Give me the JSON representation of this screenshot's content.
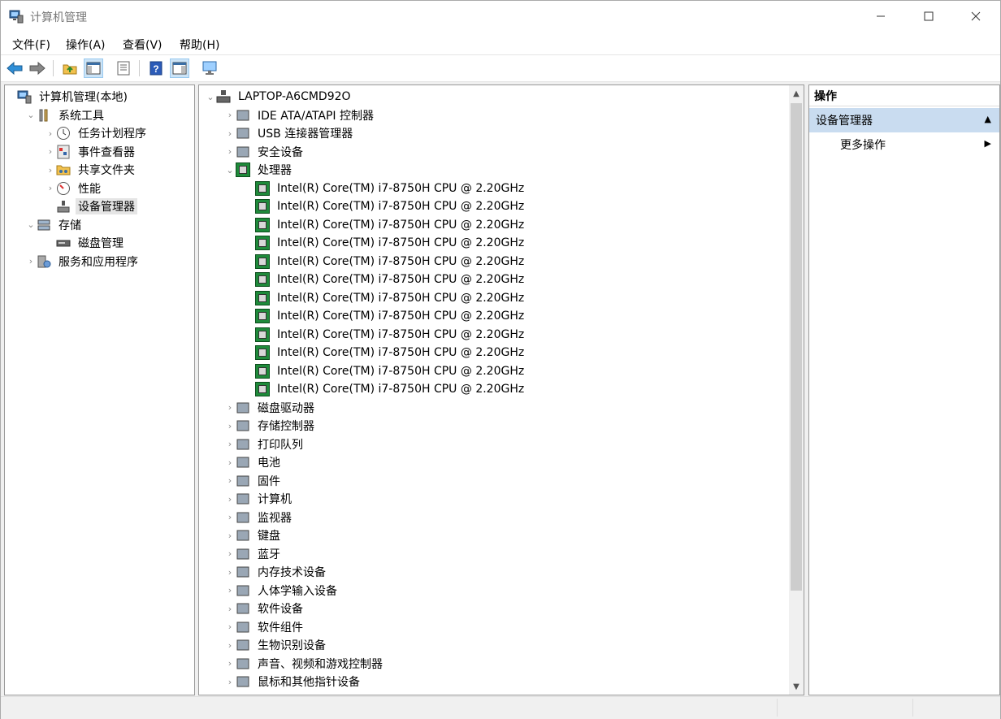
{
  "window": {
    "title": "计算机管理"
  },
  "menu": [
    "文件(F)",
    "操作(A)",
    "查看(V)",
    "帮助(H)"
  ],
  "toolbar": [
    "back-icon",
    "forward-icon",
    "up-folder-icon",
    "show-hide-tree-icon",
    "properties-icon",
    "help-icon",
    "show-action-pane-icon",
    "monitor-icon"
  ],
  "left_tree": [
    {
      "label": "计算机管理(本地)",
      "icon": "computer-management-icon",
      "level": 0,
      "chev": ""
    },
    {
      "label": "系统工具",
      "icon": "tools-icon",
      "level": 1,
      "chev": "expanded"
    },
    {
      "label": "任务计划程序",
      "icon": "clock-icon",
      "level": 2,
      "chev": "collapsed"
    },
    {
      "label": "事件查看器",
      "icon": "event-viewer-icon",
      "level": 2,
      "chev": "collapsed"
    },
    {
      "label": "共享文件夹",
      "icon": "shared-folder-icon",
      "level": 2,
      "chev": "collapsed"
    },
    {
      "label": "性能",
      "icon": "performance-icon",
      "level": 2,
      "chev": "collapsed"
    },
    {
      "label": "设备管理器",
      "icon": "device-manager-icon",
      "level": 2,
      "chev": "",
      "selected": true
    },
    {
      "label": "存储",
      "icon": "storage-icon",
      "level": 1,
      "chev": "expanded"
    },
    {
      "label": "磁盘管理",
      "icon": "disk-management-icon",
      "level": 2,
      "chev": ""
    },
    {
      "label": "服务和应用程序",
      "icon": "services-icon",
      "level": 1,
      "chev": "collapsed"
    }
  ],
  "device_tree": {
    "root": "LAPTOP-A6CMD92O",
    "categories_before": [
      {
        "label": "IDE ATA/ATAPI 控制器",
        "icon": "ide-controller-icon"
      },
      {
        "label": "USB 连接器管理器",
        "icon": "usb-icon"
      },
      {
        "label": "安全设备",
        "icon": "security-device-icon"
      }
    ],
    "processor": {
      "label": "处理器",
      "items": [
        "Intel(R) Core(TM) i7-8750H CPU @ 2.20GHz",
        "Intel(R) Core(TM) i7-8750H CPU @ 2.20GHz",
        "Intel(R) Core(TM) i7-8750H CPU @ 2.20GHz",
        "Intel(R) Core(TM) i7-8750H CPU @ 2.20GHz",
        "Intel(R) Core(TM) i7-8750H CPU @ 2.20GHz",
        "Intel(R) Core(TM) i7-8750H CPU @ 2.20GHz",
        "Intel(R) Core(TM) i7-8750H CPU @ 2.20GHz",
        "Intel(R) Core(TM) i7-8750H CPU @ 2.20GHz",
        "Intel(R) Core(TM) i7-8750H CPU @ 2.20GHz",
        "Intel(R) Core(TM) i7-8750H CPU @ 2.20GHz",
        "Intel(R) Core(TM) i7-8750H CPU @ 2.20GHz",
        "Intel(R) Core(TM) i7-8750H CPU @ 2.20GHz"
      ]
    },
    "categories_after": [
      {
        "label": "磁盘驱动器",
        "icon": "disk-drive-icon"
      },
      {
        "label": "存储控制器",
        "icon": "storage-controller-icon"
      },
      {
        "label": "打印队列",
        "icon": "printer-icon"
      },
      {
        "label": "电池",
        "icon": "battery-icon"
      },
      {
        "label": "固件",
        "icon": "firmware-icon"
      },
      {
        "label": "计算机",
        "icon": "computer-icon"
      },
      {
        "label": "监视器",
        "icon": "monitor-icon"
      },
      {
        "label": "键盘",
        "icon": "keyboard-icon"
      },
      {
        "label": "蓝牙",
        "icon": "bluetooth-icon"
      },
      {
        "label": "内存技术设备",
        "icon": "memory-device-icon"
      },
      {
        "label": "人体学输入设备",
        "icon": "hid-icon"
      },
      {
        "label": "软件设备",
        "icon": "software-device-icon"
      },
      {
        "label": "软件组件",
        "icon": "software-component-icon"
      },
      {
        "label": "生物识别设备",
        "icon": "biometric-icon"
      },
      {
        "label": "声音、视频和游戏控制器",
        "icon": "audio-icon"
      },
      {
        "label": "鼠标和其他指针设备",
        "icon": "mouse-icon"
      }
    ]
  },
  "actions": {
    "header": "操作",
    "selected": "设备管理器",
    "more": "更多操作"
  }
}
